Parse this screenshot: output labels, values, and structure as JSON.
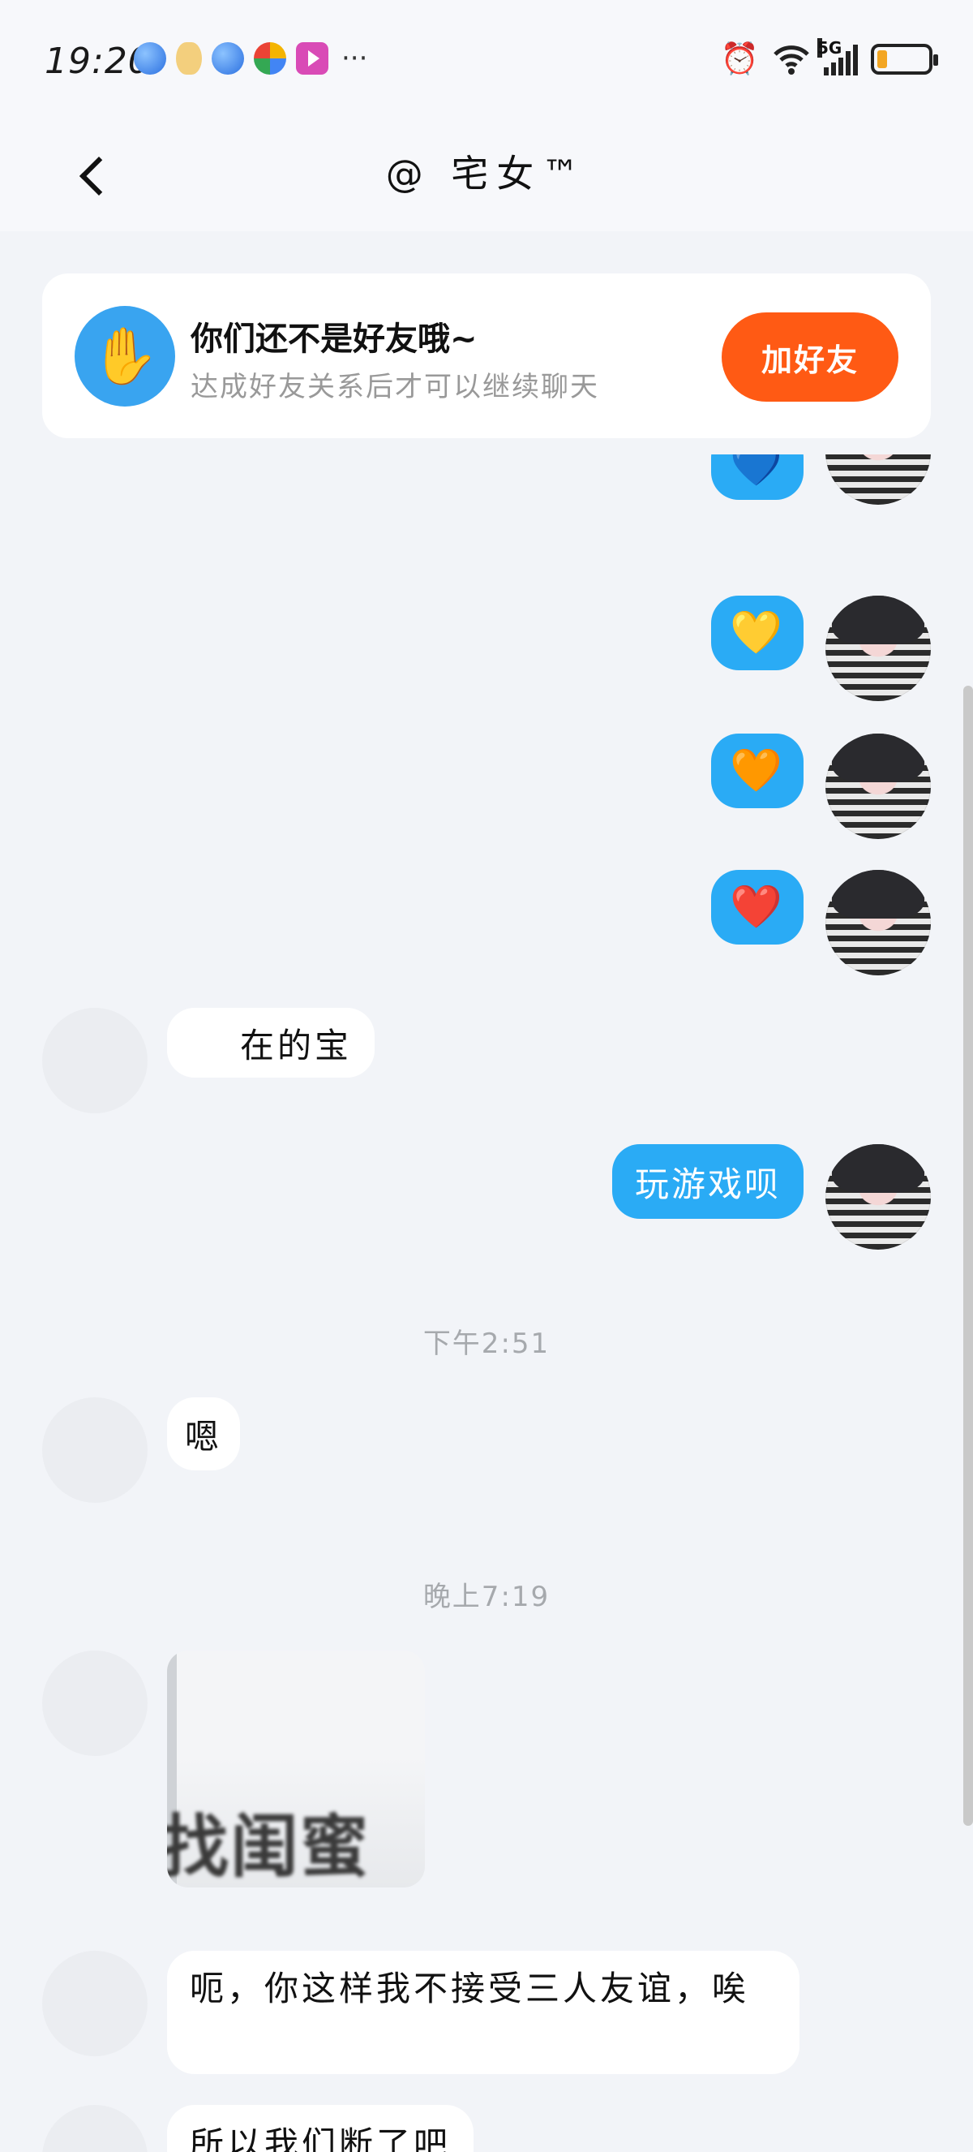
{
  "status_bar": {
    "time": "19:20",
    "notification_icons": [
      "globe-icon",
      "coin-icon",
      "globe-icon",
      "pinwheel-icon",
      "video-icon"
    ],
    "more": "···",
    "network": "5G",
    "battery_level": 0.2,
    "battery_color": "#f3a623"
  },
  "header": {
    "title": "@   宅女™",
    "back_icon": "chevron-left-icon"
  },
  "friend_banner": {
    "title": "你们还不是好友哦~",
    "subtitle": "达成好友关系后才可以继续聊天",
    "button_label": "加好友",
    "button_color": "#ff5a14",
    "icon_color": "#39a4f0"
  },
  "messages": [
    {
      "side": "self",
      "type": "emoji",
      "text": "💙"
    },
    {
      "side": "self",
      "type": "emoji",
      "text": "💛"
    },
    {
      "side": "self",
      "type": "emoji",
      "text": "🧡"
    },
    {
      "side": "self",
      "type": "emoji",
      "text": "❤️"
    },
    {
      "side": "other",
      "type": "text",
      "text": "在的宝"
    },
    {
      "side": "self",
      "type": "text",
      "text": "玩游戏呗"
    },
    {
      "type": "timestamp",
      "text": "下午2:51"
    },
    {
      "side": "other",
      "type": "text",
      "text": "嗯"
    },
    {
      "type": "timestamp",
      "text": "晚上7:19"
    },
    {
      "side": "other",
      "type": "image",
      "caption_text": "找闺蜜"
    },
    {
      "side": "other",
      "type": "text",
      "text": "呃，你这样我不接受三人友谊，唉"
    },
    {
      "side": "other",
      "type": "text",
      "text": "所以我们断了吧"
    }
  ],
  "colors": {
    "self_bubble": "#2aabf5",
    "other_bubble": "#ffffff",
    "background": "#f2f4f8"
  }
}
